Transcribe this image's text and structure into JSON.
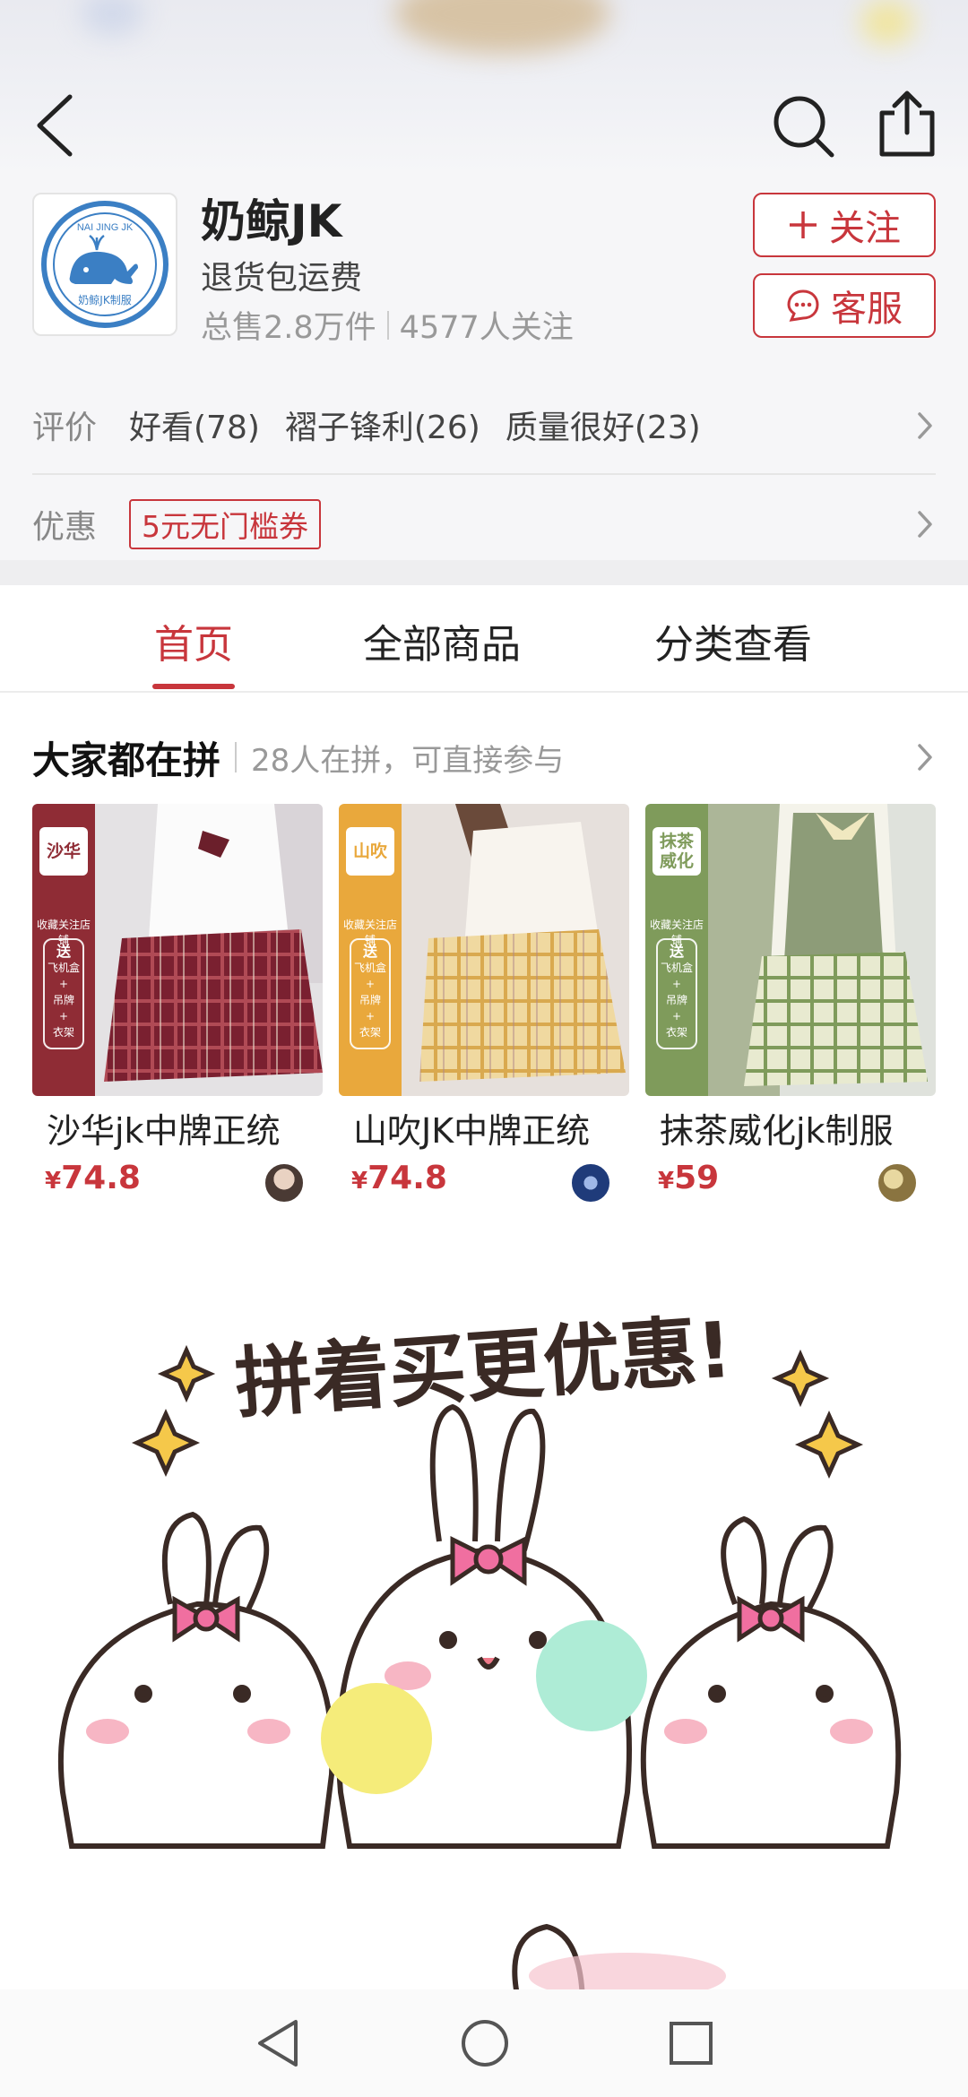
{
  "header": {
    "back_icon": "back-arrow-icon",
    "search_icon": "search-icon",
    "share_icon": "share-icon"
  },
  "shop": {
    "logo_top_text": "NAI JING JK",
    "logo_bottom_text": "奶鲸JK制服",
    "name": "奶鲸JK",
    "subtitle": "退货包运费",
    "sales": "总售2.8万件",
    "followers": "4577人关注",
    "follow_button": "关注",
    "service_button": "客服"
  },
  "reviews": {
    "label": "评价",
    "tags": [
      "好看(78)",
      "褶子锋利(26)",
      "质量很好(23)"
    ]
  },
  "coupon": {
    "label": "优惠",
    "tag": "5元无门槛券"
  },
  "tabs": [
    {
      "label": "首页",
      "active": true
    },
    {
      "label": "全部商品",
      "active": false
    },
    {
      "label": "分类查看",
      "active": false
    }
  ],
  "group_buy": {
    "title": "大家都在拼",
    "subtitle": "28人在拼，可直接参与",
    "products": [
      {
        "badge": "沙华",
        "side_text": "收藏关注店铺",
        "side_box": [
          "送",
          "飞机盒",
          "+",
          "吊牌",
          "+",
          "衣架"
        ],
        "name": "沙华jk中牌正统",
        "currency": "¥",
        "price": "74.8",
        "accent": "#8f2c35"
      },
      {
        "badge": "山吹",
        "side_text": "收藏关注店铺",
        "side_box": [
          "送",
          "飞机盒",
          "+",
          "吊牌",
          "+",
          "衣架"
        ],
        "name": "山吹JK中牌正统",
        "currency": "¥",
        "price": "74.8",
        "accent": "#e9a83c"
      },
      {
        "badge": "抹茶威化",
        "side_text": "收藏关注店铺",
        "side_box": [
          "送",
          "飞机盒",
          "+",
          "吊牌",
          "+",
          "衣架"
        ],
        "name": "抹茶威化jk制服",
        "currency": "¥",
        "price": "59",
        "accent": "#7f9b5b"
      }
    ]
  },
  "banner": {
    "text": "拼着买更优惠!"
  },
  "system_nav": {
    "back": "nav-back-icon",
    "home": "nav-home-icon",
    "recent": "nav-recent-icon"
  },
  "colors": {
    "accent": "#c8363c",
    "background": "#ffffff"
  }
}
